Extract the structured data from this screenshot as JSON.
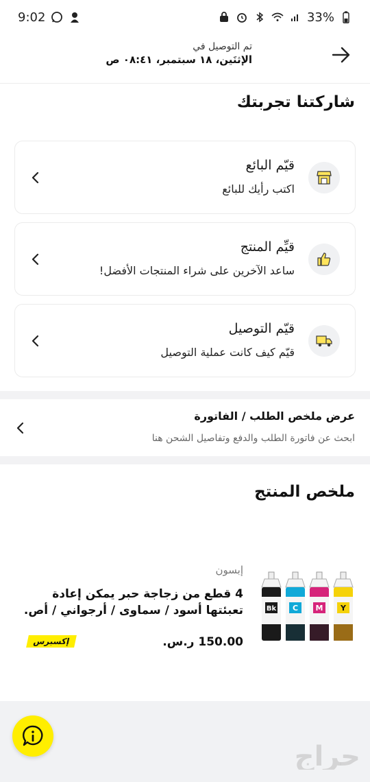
{
  "status_bar": {
    "time": "9:02",
    "battery": "33%",
    "left_icons": [
      "whatsapp-icon",
      "notification-icon"
    ],
    "right_icons": [
      "lock-icon",
      "alarm-icon",
      "bluetooth-icon",
      "wifi-icon",
      "signal-icon",
      "battery-icon"
    ]
  },
  "header": {
    "subtitle": "تم التوصيل في",
    "date": "الإثنَين، ١٨ سبتمبر، ٠٨:٤١ ص",
    "back_icon": "arrow-right-icon"
  },
  "feedback": {
    "title": "شاركتنا تجربتك",
    "cards": [
      {
        "title": "قيّم البائع",
        "subtitle": "اكتب رأيك للبائع",
        "icon": "store-icon"
      },
      {
        "title": "قيِّم المنتج",
        "subtitle": "ساعد الآخرين على شراء المنتجات الأفضل!",
        "icon": "thumbs-up-icon"
      },
      {
        "title": "قيّم التوصيل",
        "subtitle": "قيّم كيف كانت عملية التوصيل",
        "icon": "delivery-truck-icon"
      }
    ]
  },
  "order_summary": {
    "title": "عرض ملخص الطلب / الفاتورة",
    "subtitle": "ابحث عن فاتورة الطلب والدفع وتفاصيل الشحن هنا"
  },
  "product_summary": {
    "title": "ملخص المنتج",
    "brand": "إبسون",
    "name": "4 قطع من زجاجة حبر يمكن إعادة تعبئتها أسود / سماوى / أرجواني / أص.",
    "price": "150.00 ر.س.",
    "badge": "إكسبرس",
    "bottle_labels": [
      "Bk",
      "C",
      "M",
      "Y"
    ]
  },
  "watermark": "حراج",
  "colors": {
    "accent_yellow": "#ffee00",
    "ink_black": "#1a1a1a",
    "ink_cyan": "#11a9d8",
    "ink_magenta": "#d6247a",
    "ink_yellow": "#f5d20a"
  }
}
